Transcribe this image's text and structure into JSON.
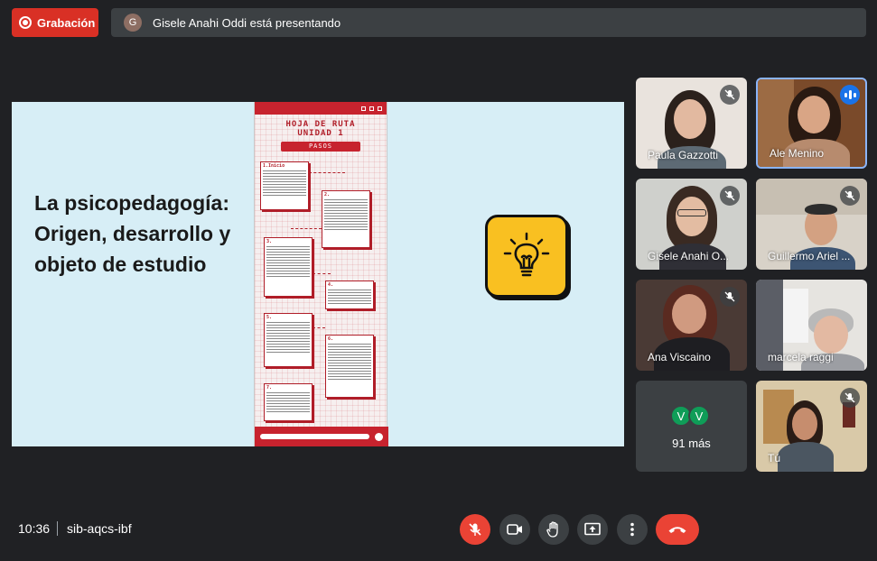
{
  "top_bar": {
    "recording_label": "Grabación",
    "presenter_initial": "G",
    "presenting_text": "Gisele Anahi Oddi está presentando"
  },
  "slide": {
    "title": "La psicopedagogía: Origen, desarrollo y objeto de estudio",
    "poster": {
      "title_line1": "HOJA DE RUTA",
      "title_line2": "UNIDAD 1",
      "subtitle": "PASOS",
      "steps": [
        "1.Inicio",
        "2.",
        "3.",
        "4.",
        "5.",
        "6.",
        "7."
      ]
    }
  },
  "participants": [
    {
      "name": "Paula Gazzotti",
      "muted": true
    },
    {
      "name": "Ale Menino",
      "speaking": true
    },
    {
      "name": "Gisele Anahi O...",
      "muted": true
    },
    {
      "name": "Guillermo Ariel ...",
      "muted": true
    },
    {
      "name": "Ana Viscaino",
      "muted": true
    },
    {
      "name": "marcela raggi",
      "muted": false
    },
    {
      "name": "Tú",
      "muted": true
    }
  ],
  "more_tile": {
    "avatars": [
      "V",
      "V"
    ],
    "label": "91 más"
  },
  "bottom_bar": {
    "time": "10:36",
    "meeting_code": "sib-aqcs-ibf"
  },
  "colors": {
    "recording": "#d93025",
    "end_call": "#ea4335",
    "speaking": "#1a73e8",
    "bulb_tile": "#f9c021",
    "poster_accent": "#c7232e"
  }
}
